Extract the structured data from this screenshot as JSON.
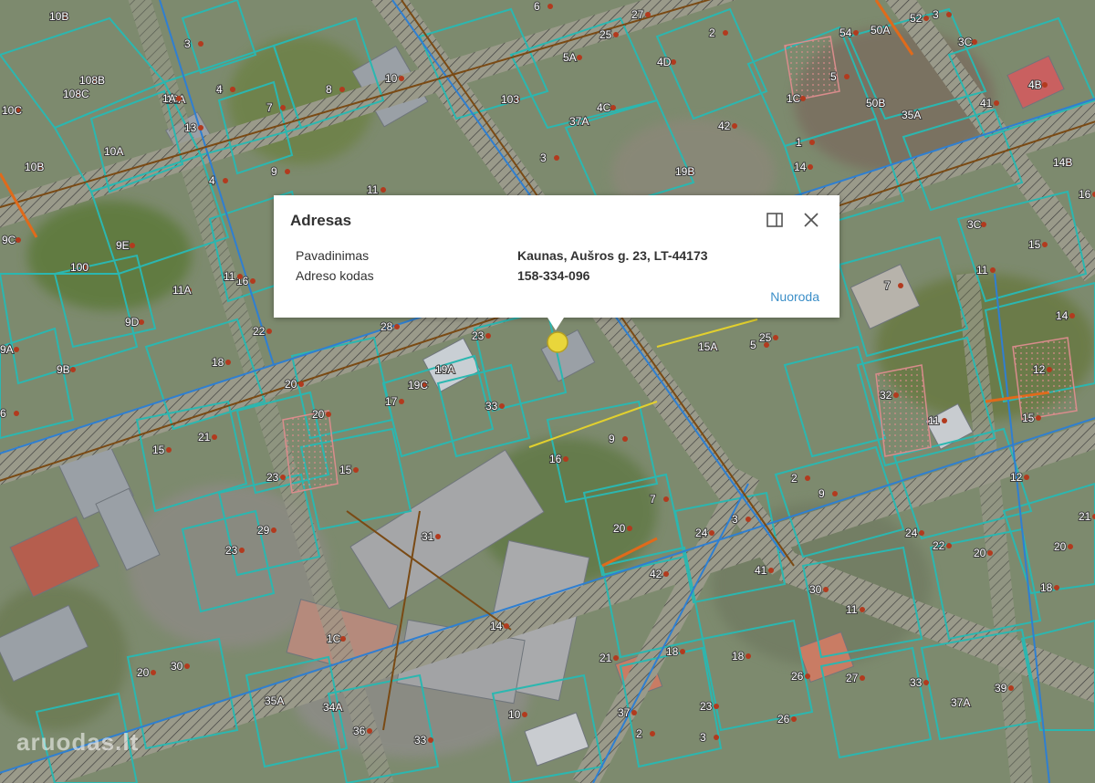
{
  "popup": {
    "title": "Adresas",
    "rows": [
      {
        "label": "Pavadinimas",
        "value": "Kaunas, Aušros g. 23, LT-44173"
      },
      {
        "label": "Adreso kodas",
        "value": "158-334-096"
      }
    ],
    "link": "Nuoroda",
    "dock_icon": "dock-panel-icon",
    "close_icon": "close-icon"
  },
  "map": {
    "house_labels": [
      "10B",
      "3",
      "6",
      "27",
      "25",
      "5A",
      "8",
      "54",
      "52",
      "3C",
      "4B",
      "50A",
      "108B",
      "108C",
      "10",
      "10A",
      "4",
      "5",
      "50B",
      "35A",
      "37A",
      "4C",
      "4D",
      "42",
      "6",
      "2",
      "3",
      "41",
      "1C",
      "1",
      "1A",
      "10C",
      "103",
      "13",
      "7",
      "9",
      "3",
      "19B",
      "14",
      "10A",
      "14B",
      "16",
      "10B",
      "4",
      "11",
      "3C",
      "9C",
      "100",
      "9E",
      "9D",
      "11A",
      "16",
      "11",
      "22",
      "28",
      "23",
      "15A",
      "25",
      "5",
      "6",
      "9A",
      "9B",
      "18",
      "20",
      "19A",
      "19C",
      "17",
      "20",
      "33",
      "32",
      "7",
      "11",
      "15",
      "14",
      "12",
      "15",
      "11",
      "15",
      "23",
      "21",
      "15",
      "16",
      "9",
      "7",
      "20",
      "24",
      "23",
      "29",
      "31",
      "3",
      "2",
      "9",
      "24",
      "22",
      "20",
      "20",
      "21",
      "12",
      "42",
      "41",
      "30",
      "18",
      "11",
      "1C",
      "14",
      "20",
      "30",
      "21",
      "18",
      "18",
      "26",
      "27",
      "33",
      "39",
      "37A",
      "37",
      "23",
      "26",
      "35A",
      "34A",
      "36",
      "33",
      "10",
      "2",
      "3"
    ],
    "watermark": "aruodas.lt",
    "colors": {
      "parcel": "#2bb7b0",
      "road_hatch": "#3b3b3b",
      "pipe_blue": "#2f7fd1",
      "pipe_orange": "#e06a1b",
      "pipe_brown": "#7a4a14",
      "marker": "#e9d63b"
    }
  }
}
